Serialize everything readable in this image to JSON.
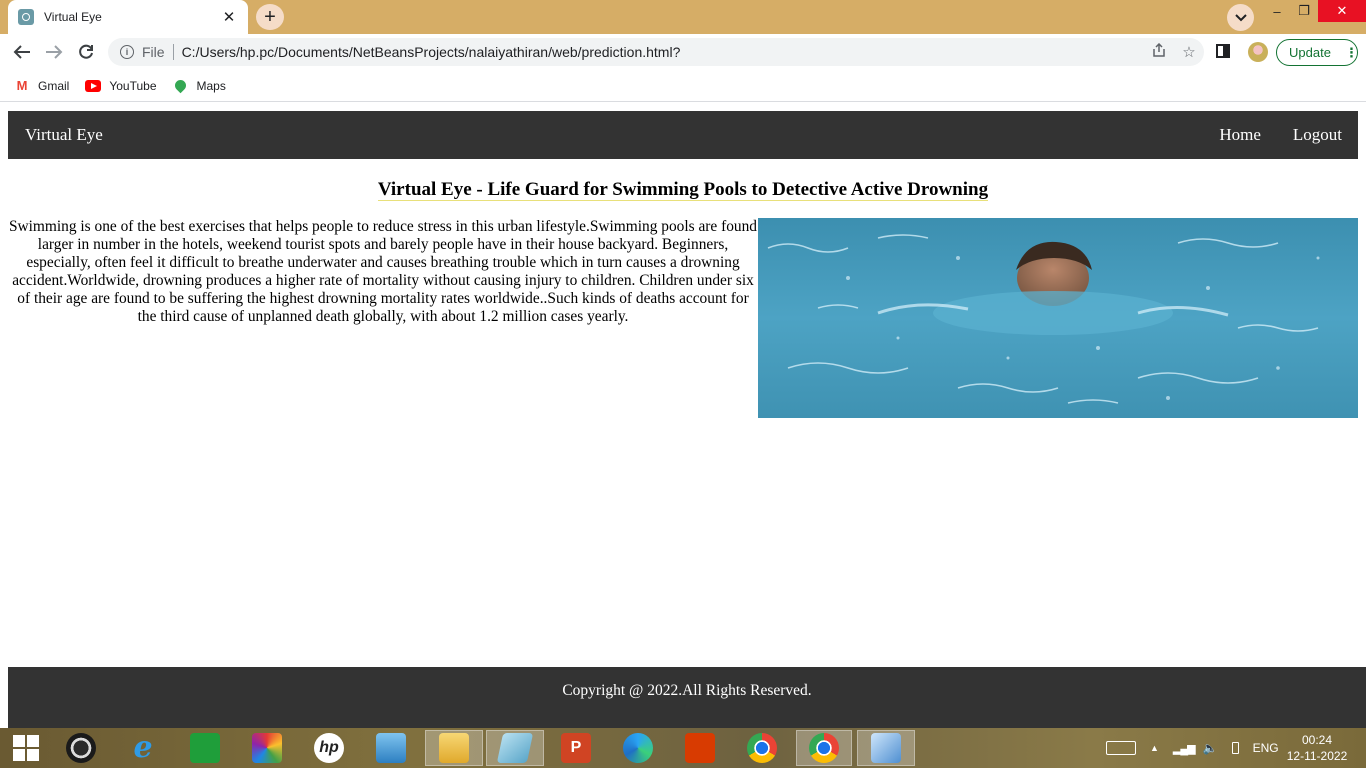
{
  "browser": {
    "tab_title": "Virtual Eye",
    "tab_close": "✕",
    "new_tab": "+",
    "address": {
      "scheme_label": "File",
      "url": "C:/Users/hp.pc/Documents/NetBeansProjects/nalaiyathiran/web/prediction.html?"
    },
    "update_label": "Update",
    "update_menu": "⋮",
    "bookmarks": [
      {
        "label": "Gmail",
        "icon": "gmail-icon"
      },
      {
        "label": "YouTube",
        "icon": "youtube-icon"
      },
      {
        "label": "Maps",
        "icon": "maps-icon"
      }
    ],
    "window_controls": {
      "minimize": "–",
      "maximize": "❐",
      "close": "✕"
    }
  },
  "page": {
    "brand": "Virtual Eye",
    "nav": {
      "home": "Home",
      "logout": "Logout"
    },
    "heading": "Virtual Eye - Life Guard for Swimming Pools to Detective Active Drowning",
    "intro": "Swimming is one of the best exercises that helps people to reduce stress in this urban lifestyle.Swimming pools are found larger in number in the hotels, weekend tourist spots and barely people have in their house backyard. Beginners, especially, often feel it difficult to breathe underwater and causes breathing trouble which in turn causes a drowning accident.Worldwide, drowning produces a higher rate of mortality without causing injury to children. Children under six of their age are found to be suffering the highest drowning mortality rates worldwide..Such kinds of deaths account for the third cause of unplanned death globally, with about 1.2 million cases yearly.",
    "footer": "Copyright @ 2022.All Rights Reserved."
  },
  "taskbar": {
    "language": "ENG",
    "time": "00:24",
    "date": "12-11-2022"
  },
  "colors": {
    "titlebar": "#d6ad66",
    "navbar": "#333333",
    "update_green": "#137333",
    "close_red": "#e81123"
  }
}
